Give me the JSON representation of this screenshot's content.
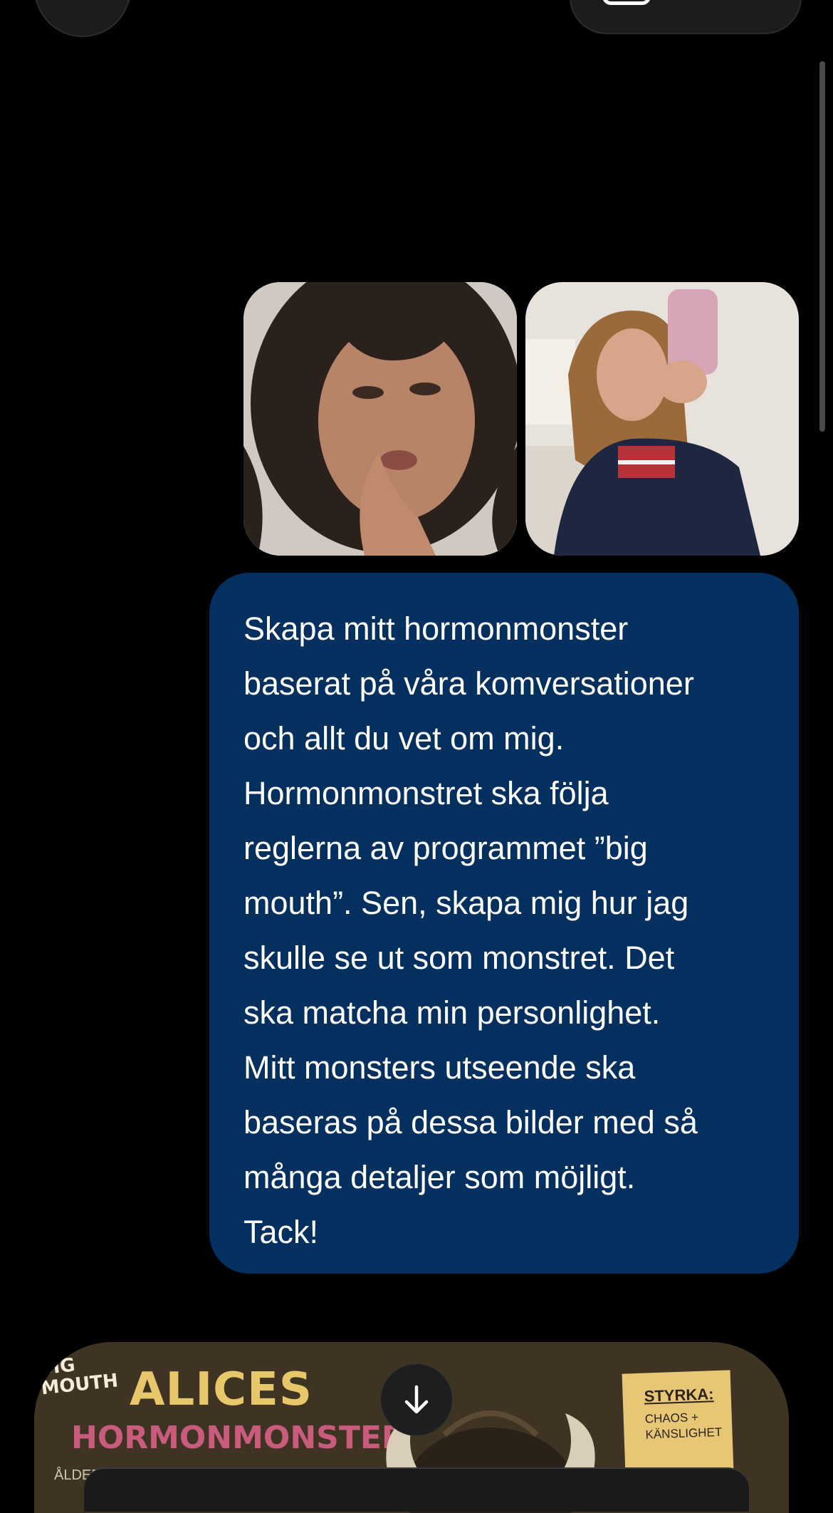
{
  "header": {
    "left_button_icon": "back-icon",
    "right_button_icon": "share-icon"
  },
  "attachments": [
    {
      "description_icon": "photo-thumbnail",
      "kind": "selfie-photo"
    },
    {
      "description_icon": "photo-thumbnail",
      "kind": "mirror-selfie-photo"
    }
  ],
  "message": {
    "text": "Skapa mitt hormonmonster\nbaserat på våra komversationer\noch allt du vet om mig.\nHormonmonstret ska följa\nreglerna av programmet ”big\nmouth”. Sen, skapa mig hur jag\nskulle se ut som monstret. Det\nska matcha min personlighet.\nMitt monsters utseende ska\nbaseras på dessa bilder med så\nmånga detaljer som möjligt.\nTack!"
  },
  "result_image": {
    "logo_small": "BIG\nMOUTH",
    "title": "ALICES",
    "subtitle": "HORMONMONSTER",
    "age_label": "ÅLDER",
    "note_title": "STYRKA:",
    "note_body": "CHAOS +\nKÄNSLIGHET"
  },
  "scroll_button_icon": "arrow-down-icon",
  "colors": {
    "background": "#000000",
    "bubble": "#04305f",
    "text": "#ffffff"
  }
}
